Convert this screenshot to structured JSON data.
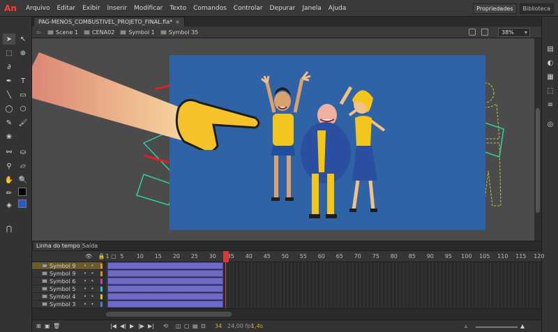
{
  "app": {
    "logo": "An",
    "menu": [
      "Arquivo",
      "Editar",
      "Exibir",
      "Inserir",
      "Modificar",
      "Texto",
      "Comandos",
      "Controlar",
      "Depurar",
      "Janela",
      "Ajuda"
    ],
    "right_tabs": [
      "Propriedades",
      "Biblioteca"
    ]
  },
  "document": {
    "tab_label": "PAG-MENOS_COMBUSTIVEL_PROJETO_FINAL.fla*",
    "close_glyph": "×"
  },
  "breadcrumb": {
    "items": [
      "Scene 1",
      "CENA02",
      "Symbol 1",
      "Symbol 35"
    ],
    "zoom": "38%"
  },
  "timeline": {
    "tabs": [
      "Linha do tempo",
      "Saída"
    ],
    "ruler": [
      "1",
      "5",
      "10",
      "15",
      "20",
      "25",
      "30",
      "35",
      "40",
      "45",
      "50",
      "55",
      "60",
      "65",
      "70",
      "75",
      "80",
      "85",
      "90",
      "95",
      "100",
      "105",
      "110",
      "115",
      "120"
    ],
    "layers": [
      {
        "name": "Symbol 9",
        "color": "#d89a2e",
        "selected": true
      },
      {
        "name": "Symbol 9",
        "color": "#e08a2e",
        "selected": false
      },
      {
        "name": "Symbol 6",
        "color": "#c040c0",
        "selected": false
      },
      {
        "name": "Symbol 5",
        "color": "#30c0d0",
        "selected": false
      },
      {
        "name": "Symbol 4",
        "color": "#e0c030",
        "selected": false
      },
      {
        "name": "Symbol 3",
        "color": "#4080e0",
        "selected": false
      }
    ],
    "current_frame": "34",
    "fps": "24,00 fps",
    "time": "1,4s",
    "playhead_frame": 34
  },
  "colors": {
    "stage_bg": "#2f63a6",
    "stroke_color": "#000000",
    "fill_color": "#1e5dc4",
    "accent": "#d63a3a"
  }
}
